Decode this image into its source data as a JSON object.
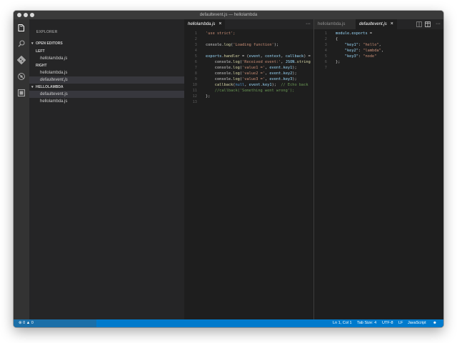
{
  "window": {
    "title": "defaultevent.js — hellolambda"
  },
  "activity_icons": [
    "files-icon",
    "search-icon",
    "git-icon",
    "debug-icon",
    "extensions-icon"
  ],
  "sidebar": {
    "title": "EXPLORER",
    "open_editors": {
      "label": "OPEN EDITORS",
      "groups": [
        {
          "label": "LEFT",
          "files": [
            {
              "name": "hellolambda.js",
              "italic": true
            }
          ]
        },
        {
          "label": "RIGHT",
          "files": [
            {
              "name": "hellolambda.js",
              "italic": false
            },
            {
              "name": "defaultevent.js",
              "italic": true
            }
          ]
        }
      ]
    },
    "project": {
      "label": "HELLOLAMBDA",
      "files": [
        {
          "name": "defaultevent.js",
          "selected": true
        },
        {
          "name": "hellolambda.js",
          "selected": false
        }
      ]
    }
  },
  "left_editor": {
    "tab": {
      "label": "hellolambda.js",
      "close": "×"
    },
    "more": "···",
    "lines": [
      [
        {
          "t": "'use strict';",
          "c": "str"
        }
      ],
      [],
      [
        {
          "t": "console",
          "c": "plain"
        },
        {
          "t": ".",
          "c": "plain"
        },
        {
          "t": "log",
          "c": "fn"
        },
        {
          "t": "(",
          "c": "plain"
        },
        {
          "t": "'Loading function'",
          "c": "str"
        },
        {
          "t": ");",
          "c": "plain"
        }
      ],
      [],
      [
        {
          "t": "exports",
          "c": "var"
        },
        {
          "t": ".",
          "c": "plain"
        },
        {
          "t": "handler",
          "c": "fn"
        },
        {
          "t": " = (",
          "c": "plain"
        },
        {
          "t": "event",
          "c": "var"
        },
        {
          "t": ", ",
          "c": "plain"
        },
        {
          "t": "context",
          "c": "var"
        },
        {
          "t": ", ",
          "c": "plain"
        },
        {
          "t": "callback",
          "c": "var"
        },
        {
          "t": ") =",
          "c": "plain"
        }
      ],
      [
        {
          "t": "    console",
          "c": "plain"
        },
        {
          "t": ".",
          "c": "plain"
        },
        {
          "t": "log",
          "c": "fn"
        },
        {
          "t": "(",
          "c": "plain"
        },
        {
          "t": "'Received event:'",
          "c": "str"
        },
        {
          "t": ", ",
          "c": "plain"
        },
        {
          "t": "JSON",
          "c": "var"
        },
        {
          "t": ".",
          "c": "plain"
        },
        {
          "t": "string",
          "c": "fn"
        }
      ],
      [
        {
          "t": "    console",
          "c": "plain"
        },
        {
          "t": ".",
          "c": "plain"
        },
        {
          "t": "log",
          "c": "fn"
        },
        {
          "t": "(",
          "c": "plain"
        },
        {
          "t": "'value1 ='",
          "c": "str"
        },
        {
          "t": ", ",
          "c": "plain"
        },
        {
          "t": "event",
          "c": "var"
        },
        {
          "t": ".",
          "c": "plain"
        },
        {
          "t": "key1",
          "c": "var"
        },
        {
          "t": ");",
          "c": "plain"
        }
      ],
      [
        {
          "t": "    console",
          "c": "plain"
        },
        {
          "t": ".",
          "c": "plain"
        },
        {
          "t": "log",
          "c": "fn"
        },
        {
          "t": "(",
          "c": "plain"
        },
        {
          "t": "'value2 ='",
          "c": "str"
        },
        {
          "t": ", ",
          "c": "plain"
        },
        {
          "t": "event",
          "c": "var"
        },
        {
          "t": ".",
          "c": "plain"
        },
        {
          "t": "key2",
          "c": "var"
        },
        {
          "t": ");",
          "c": "plain"
        }
      ],
      [
        {
          "t": "    console",
          "c": "plain"
        },
        {
          "t": ".",
          "c": "plain"
        },
        {
          "t": "log",
          "c": "fn"
        },
        {
          "t": "(",
          "c": "plain"
        },
        {
          "t": "'value3 ='",
          "c": "str"
        },
        {
          "t": ", ",
          "c": "plain"
        },
        {
          "t": "event",
          "c": "var"
        },
        {
          "t": ".",
          "c": "plain"
        },
        {
          "t": "key3",
          "c": "var"
        },
        {
          "t": ");",
          "c": "plain"
        }
      ],
      [
        {
          "t": "    callback",
          "c": "fn"
        },
        {
          "t": "(",
          "c": "plain"
        },
        {
          "t": "null",
          "c": "kw"
        },
        {
          "t": ", ",
          "c": "plain"
        },
        {
          "t": "event",
          "c": "var"
        },
        {
          "t": ".",
          "c": "plain"
        },
        {
          "t": "key1",
          "c": "var"
        },
        {
          "t": ");  ",
          "c": "plain"
        },
        {
          "t": "// Echo back",
          "c": "com"
        }
      ],
      [
        {
          "t": "    //callback('Something went wrong');",
          "c": "com"
        }
      ],
      [
        {
          "t": "};",
          "c": "plain"
        }
      ],
      []
    ]
  },
  "right_editor": {
    "tabs": [
      {
        "label": "hellolambda.js",
        "active": false,
        "close": ""
      },
      {
        "label": "defaultevent.js",
        "active": true,
        "close": "×"
      }
    ],
    "actions": [
      "split-editor-icon",
      "toggle-layout-icon",
      "more-actions-icon"
    ],
    "more": "···",
    "lines": [
      [
        {
          "t": "module",
          "c": "var"
        },
        {
          "t": ".",
          "c": "plain"
        },
        {
          "t": "exports",
          "c": "var"
        },
        {
          "t": " =",
          "c": "plain"
        }
      ],
      [
        {
          "t": "{",
          "c": "plain"
        }
      ],
      [
        {
          "t": "    ",
          "c": "plain"
        },
        {
          "t": "\"key1\"",
          "c": "var"
        },
        {
          "t": ": ",
          "c": "plain"
        },
        {
          "t": "\"hello\"",
          "c": "str"
        },
        {
          "t": ",",
          "c": "plain"
        }
      ],
      [
        {
          "t": "    ",
          "c": "plain"
        },
        {
          "t": "\"key2\"",
          "c": "var"
        },
        {
          "t": ": ",
          "c": "plain"
        },
        {
          "t": "\"lambda\"",
          "c": "str"
        },
        {
          "t": ",",
          "c": "plain"
        }
      ],
      [
        {
          "t": "    ",
          "c": "plain"
        },
        {
          "t": "\"key3\"",
          "c": "var"
        },
        {
          "t": ": ",
          "c": "plain"
        },
        {
          "t": "\"node\"",
          "c": "str"
        }
      ],
      [
        {
          "t": "};",
          "c": "plain"
        }
      ],
      []
    ]
  },
  "status": {
    "errors": "0",
    "warnings": "0",
    "cursor": "Ln 1, Col 1",
    "tab_size": "Tab Size: 4",
    "encoding": "UTF-8",
    "eol": "LF",
    "language": "JavaScript"
  },
  "colors": {
    "accent": "#007acc",
    "string": "#ce9178",
    "function": "#dcdcaa",
    "variable": "#9cdcfe",
    "comment": "#6a9955"
  }
}
